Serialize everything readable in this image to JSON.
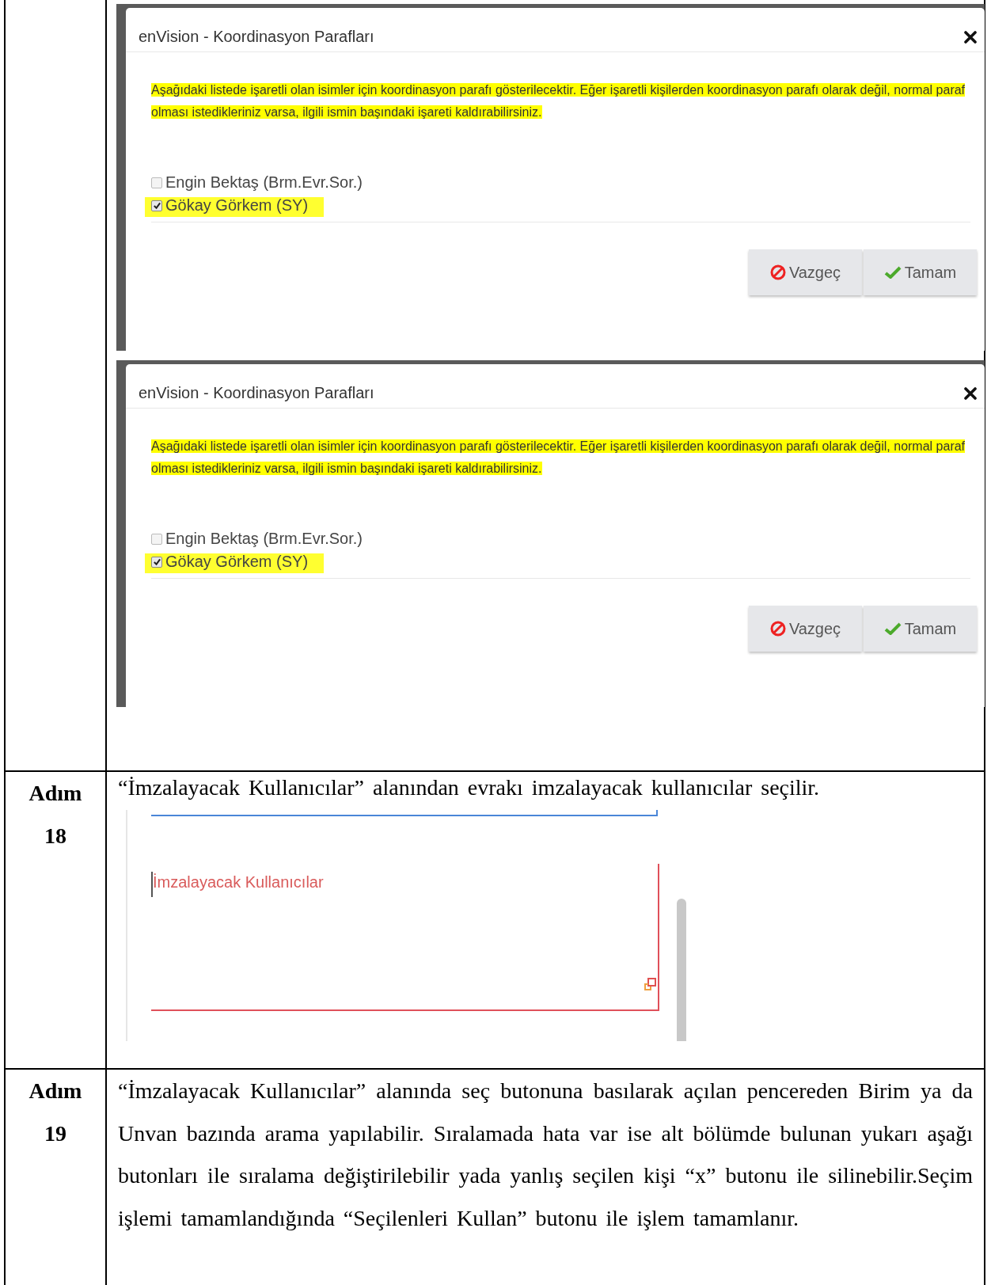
{
  "rows": [
    {
      "kind": "dialogs",
      "dialogs": [
        {
          "title": "enVision - Koordinasyon Parafları",
          "notice": "Aşağıdaki listede işaretli olan isimler için koordinasyon parafı gösterilecektir. Eğer işaretli kişilerden koordinasyon parafı olarak değil, normal paraf olması istedikleriniz varsa, ilgili ismin başındaki işareti kaldırabilirsiniz.",
          "people": [
            {
              "label": "Engin Bektaş (Brm.Evr.Sor.)",
              "checked": false,
              "highlighted": false
            },
            {
              "label": "Gökay Görkem (SY)",
              "checked": true,
              "highlighted": true
            }
          ],
          "buttons": [
            {
              "label": "Vazgeç",
              "kind": "cancel"
            },
            {
              "label": "Tamam",
              "kind": "ok"
            }
          ]
        },
        {
          "title": "enVision - Koordinasyon Parafları",
          "notice": "Aşağıdaki listede işaretli olan isimler için koordinasyon parafı gösterilecektir. Eğer işaretli kişilerden koordinasyon parafı olarak değil, normal paraf olması istedikleriniz varsa, ilgili ismin başındaki işareti kaldırabilirsiniz.",
          "people": [
            {
              "label": "Engin Bektaş (Brm.Evr.Sor.)",
              "checked": false,
              "highlighted": false
            },
            {
              "label": "Gökay Görkem (SY)",
              "checked": true,
              "highlighted": true
            }
          ],
          "buttons": [
            {
              "label": "Vazgeç",
              "kind": "cancel"
            },
            {
              "label": "Tamam",
              "kind": "ok"
            }
          ]
        }
      ]
    },
    {
      "kind": "field",
      "label": "Adım",
      "number": "18",
      "text": "“İmzalayacak Kullanıcılar” alanından evrakı imzalayacak kullanıcılar seçilir.",
      "field_label": "İmzalayacak Kullanıcılar"
    },
    {
      "kind": "text",
      "label": "Adım",
      "number": "19",
      "text": "“İmzalayacak Kullanıcılar” alanında seç butonuna basılarak açılan pencereden Birim ya da Unvan bazında arama yapılabilir. Sıralamada hata var ise alt bölümde bulunan yukarı aşağı butonları ile sıralama değiştirilebilir yada yanlış seçilen kişi “x” butonu ile silinebilir.Seçim işlemi tamamlandığında “Seçilenleri Kullan” butonu ile işlem tamamlanır."
    }
  ]
}
